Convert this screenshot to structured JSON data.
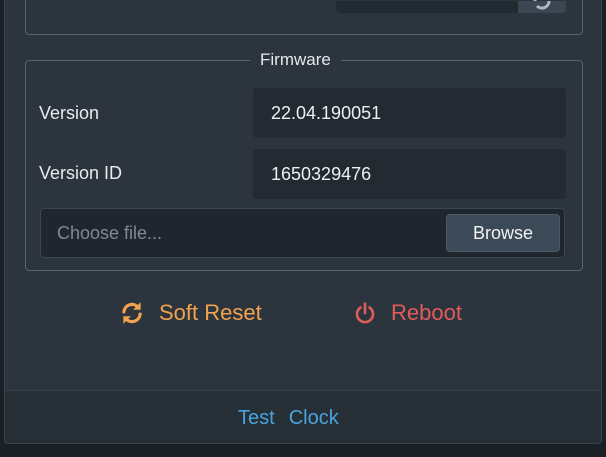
{
  "firmware": {
    "legend": "Firmware",
    "version_label": "Version",
    "version_value": "22.04.190051",
    "version_id_label": "Version ID",
    "version_id_value": "1650329476",
    "file_placeholder": "Choose file...",
    "browse_label": "Browse"
  },
  "actions": {
    "soft_reset_label": "Soft Reset",
    "soft_reset_icon": "refresh-icon",
    "soft_reset_color": "#f0a24e",
    "reboot_label": "Reboot",
    "reboot_icon": "power-icon",
    "reboot_color": "#e05c5c"
  },
  "footer": {
    "links": [
      "Test",
      "Clock"
    ],
    "link_color": "#4aa3df"
  }
}
